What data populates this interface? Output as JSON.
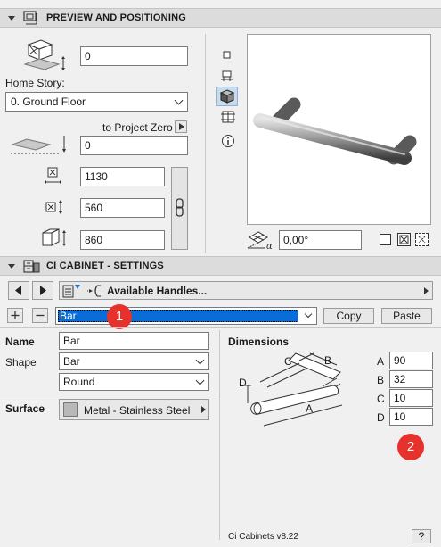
{
  "preview_section": {
    "title": "PREVIEW AND POSITIONING",
    "elevation_value": "0",
    "home_story_label": "Home Story:",
    "home_story_value": "0. Ground Floor",
    "to_project_zero_label": "to Project Zero",
    "project_zero_value": "0",
    "width_value": "1130",
    "depth_value": "560",
    "height_value": "860",
    "angle_value": "0,00°"
  },
  "settings_section": {
    "title": "CI CABINET - SETTINGS",
    "nav_label": "Available Handles...",
    "handle_value": "Bar",
    "copy_label": "Copy",
    "paste_label": "Paste",
    "name_label": "Name",
    "name_value": "Bar",
    "shape_label": "Shape",
    "shape_value": "Bar",
    "shape2_value": "Round",
    "surface_label": "Surface",
    "surface_value": "Metal - Stainless Steel",
    "dimensions_label": "Dimensions",
    "dims": [
      {
        "label": "A",
        "value": "90"
      },
      {
        "label": "B",
        "value": "32"
      },
      {
        "label": "C",
        "value": "10"
      },
      {
        "label": "D",
        "value": "10"
      }
    ],
    "diagram_labels": {
      "a": "A",
      "b": "B",
      "c": "C",
      "d": "D"
    },
    "version": "Ci Cabinets v8.22",
    "help_label": "?"
  },
  "badges": {
    "one": "1",
    "two": "2"
  },
  "colors": {
    "badge": "#e5322d",
    "selection": "#0a6cd6"
  }
}
